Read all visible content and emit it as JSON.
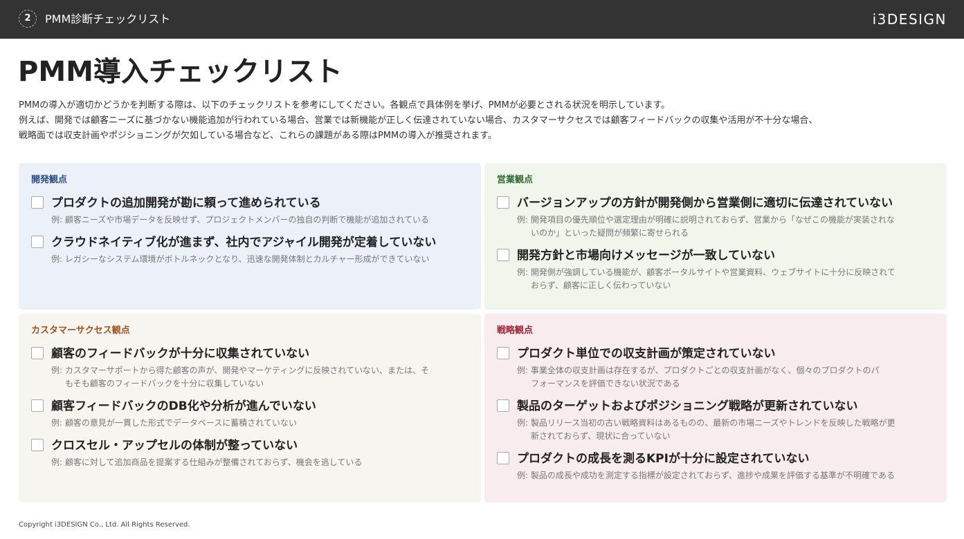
{
  "header": {
    "page_number": "2",
    "section_title": "PMM診断チェックリスト",
    "logo": "i3DESIGN"
  },
  "title": "PMM導入チェックリスト",
  "intro": [
    "PMMの導入が適切かどうかを判断する際は、以下のチェックリストを参考にしてください。各観点で具体例を挙げ、PMMが必要とされる状況を明示しています。",
    "例えば、開発では顧客ニーズに基づかない機能追加が行われている場合、営業では新機能が正しく伝達されていない場合、カスタマーサクセスでは顧客フィードバックの収集や活用が不十分な場合、",
    "戦略面では収支計画やポジショニングが欠如している場合など、これらの課題がある際はPMMの導入が推奨されます。"
  ],
  "panels": {
    "dev": {
      "label": "開発観点",
      "color": "#2c4f86",
      "items": [
        {
          "title": "プロダクトの追加開発が勘に頼って進められている",
          "example": [
            "例: 顧客ニーズや市場データを反映せず、プロジェクトメンバーの独自の判断で機能が追加されている"
          ]
        },
        {
          "title": "クラウドネイティブ化が進まず、社内でアジャイル開発が定着していない",
          "example": [
            "例: レガシーなシステム環境がボトルネックとなり、迅速な開発体制とカルチャー形成ができていない"
          ]
        }
      ]
    },
    "sales": {
      "label": "営業観点",
      "color": "#2e6b2e",
      "items": [
        {
          "title": "バージョンアップの方針が開発側から営業側に適切に伝達されていない",
          "example": [
            "例: 開発項目の優先順位や選定理由が明確に説明されておらず、営業から「なぜこの機能が実装されな",
            "いのか」といった疑問が頻繁に寄せられる"
          ]
        },
        {
          "title": "開発方針と市場向けメッセージが一致していない",
          "example": [
            "例: 開発側が強調している機能が、顧客ポータルサイトや営業資料、ウェブサイトに十分に反映されて",
            "おらず、顧客に正しく伝わっていない"
          ]
        }
      ]
    },
    "cs": {
      "label": "カスタマーサクセス観点",
      "color": "#a0521f",
      "items": [
        {
          "title": "顧客のフィードバックが十分に収集されていない",
          "example": [
            "例: カスタマーサポートから得た顧客の声が、開発やマーケティングに反映されていない、または、そ",
            "もそも顧客のフィードバックを十分に収集していない"
          ]
        },
        {
          "title": "顧客フィードバックのDB化や分析が進んでいない",
          "example": [
            "例: 顧客の意見が一貫した形式でデータベースに蓄積されていない"
          ]
        },
        {
          "title": "クロスセル・アップセルの体制が整っていない",
          "example": [
            "例: 顧客に対して追加商品を提案する仕組みが整備されておらず、機会を逃している"
          ]
        }
      ]
    },
    "strategy": {
      "label": "戦略観点",
      "color": "#9b2335",
      "items": [
        {
          "title": "プロダクト単位での収支計画が策定されていない",
          "example": [
            "例: 事業全体の収支計画は存在するが、プロダクトごとの収支計画がなく、個々のプロダクトのパ",
            "フォーマンスを評価できない状況である"
          ]
        },
        {
          "title": "製品のターゲットおよびポジショニング戦略が更新されていない",
          "example": [
            "例: 製品リリース当初の古い戦略資料はあるものの、最新の市場ニーズやトレンドを反映した戦略が更",
            "新されておらず、現状に合っていない"
          ]
        },
        {
          "title": "プロダクトの成長を測るKPIが十分に設定されていない",
          "example": [
            "例: 製品の成長や成功を測定する指標が設定されておらず、進捗や成果を評価する基準が不明確である"
          ]
        }
      ]
    }
  },
  "footer": "Copyright i3DESIGN Co., Ltd. All Rights Reserved."
}
